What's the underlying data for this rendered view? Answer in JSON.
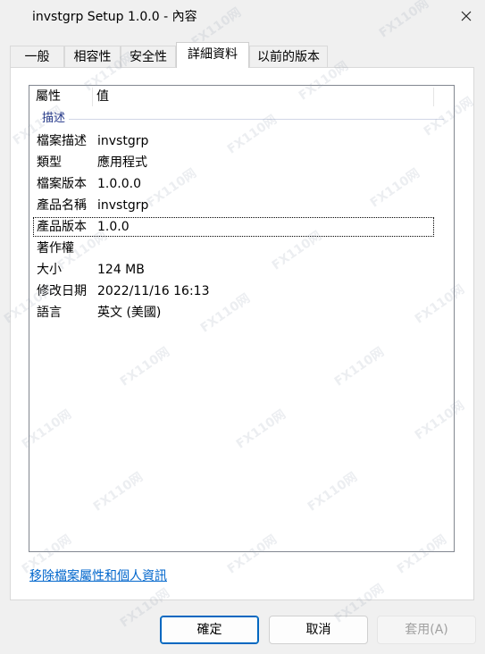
{
  "window": {
    "title": "invstgrp Setup 1.0.0 - 內容"
  },
  "tabs": [
    {
      "label": "一般"
    },
    {
      "label": "相容性"
    },
    {
      "label": "安全性"
    },
    {
      "label": "詳細資料"
    },
    {
      "label": "以前的版本"
    }
  ],
  "details": {
    "header": {
      "property": "屬性",
      "value": "值"
    },
    "group": "描述",
    "rows": [
      {
        "key": "檔案描述",
        "value": "invstgrp"
      },
      {
        "key": "類型",
        "value": "應用程式"
      },
      {
        "key": "檔案版本",
        "value": "1.0.0.0"
      },
      {
        "key": "產品名稱",
        "value": "invstgrp"
      },
      {
        "key": "產品版本",
        "value": "1.0.0"
      },
      {
        "key": "著作權",
        "value": ""
      },
      {
        "key": "大小",
        "value": "124 MB"
      },
      {
        "key": "修改日期",
        "value": "2022/11/16 16:13"
      },
      {
        "key": "語言",
        "value": "英文 (美國)"
      }
    ]
  },
  "link": "移除檔案屬性和個人資訊",
  "buttons": {
    "ok": "確定",
    "cancel": "取消",
    "apply": "套用(A)"
  },
  "watermark": "FX110网"
}
